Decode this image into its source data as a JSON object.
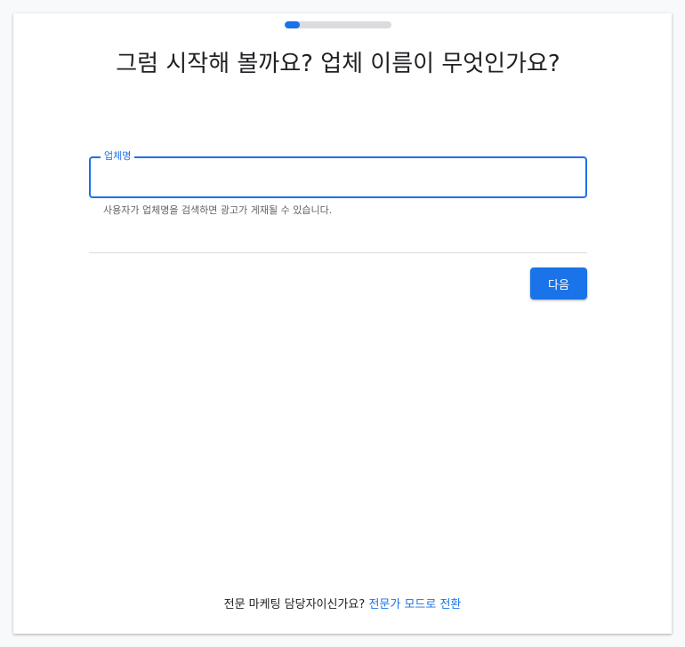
{
  "progress": {
    "value_percent": 14
  },
  "page": {
    "title": "그럼 시작해 볼까요? 업체 이름이 무엇인가요?"
  },
  "form": {
    "business_name_label": "업체명",
    "business_name_value": "",
    "helper_text": "사용자가 업체명을 검색하면 광고가 게재될 수 있습니다."
  },
  "actions": {
    "next_label": "다음"
  },
  "footer": {
    "question": "전문 마케팅 담당자이신가요?",
    "link_label": "전문가 모드로 전환"
  },
  "colors": {
    "accent": "#1a73e8",
    "text": "#202124",
    "muted": "#5f6368",
    "divider": "#dadce0"
  }
}
